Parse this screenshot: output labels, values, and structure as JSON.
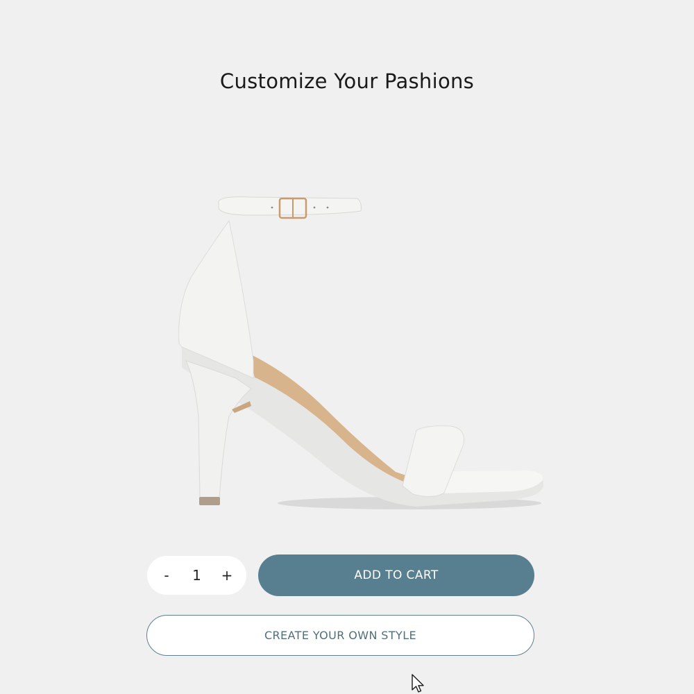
{
  "page": {
    "title": "Customize Your Pashions"
  },
  "product": {
    "image_icon": "white-ankle-strap-high-heel-sandal"
  },
  "quantity": {
    "decrement_label": "-",
    "value": "1",
    "increment_label": "+"
  },
  "actions": {
    "add_to_cart_label": "ADD TO CART",
    "create_style_label": "CREATE YOUR OWN STYLE"
  },
  "colors": {
    "background": "#f0f0f0",
    "primary_button": "#587f8f",
    "outline_button_border": "#5d7f8b"
  }
}
